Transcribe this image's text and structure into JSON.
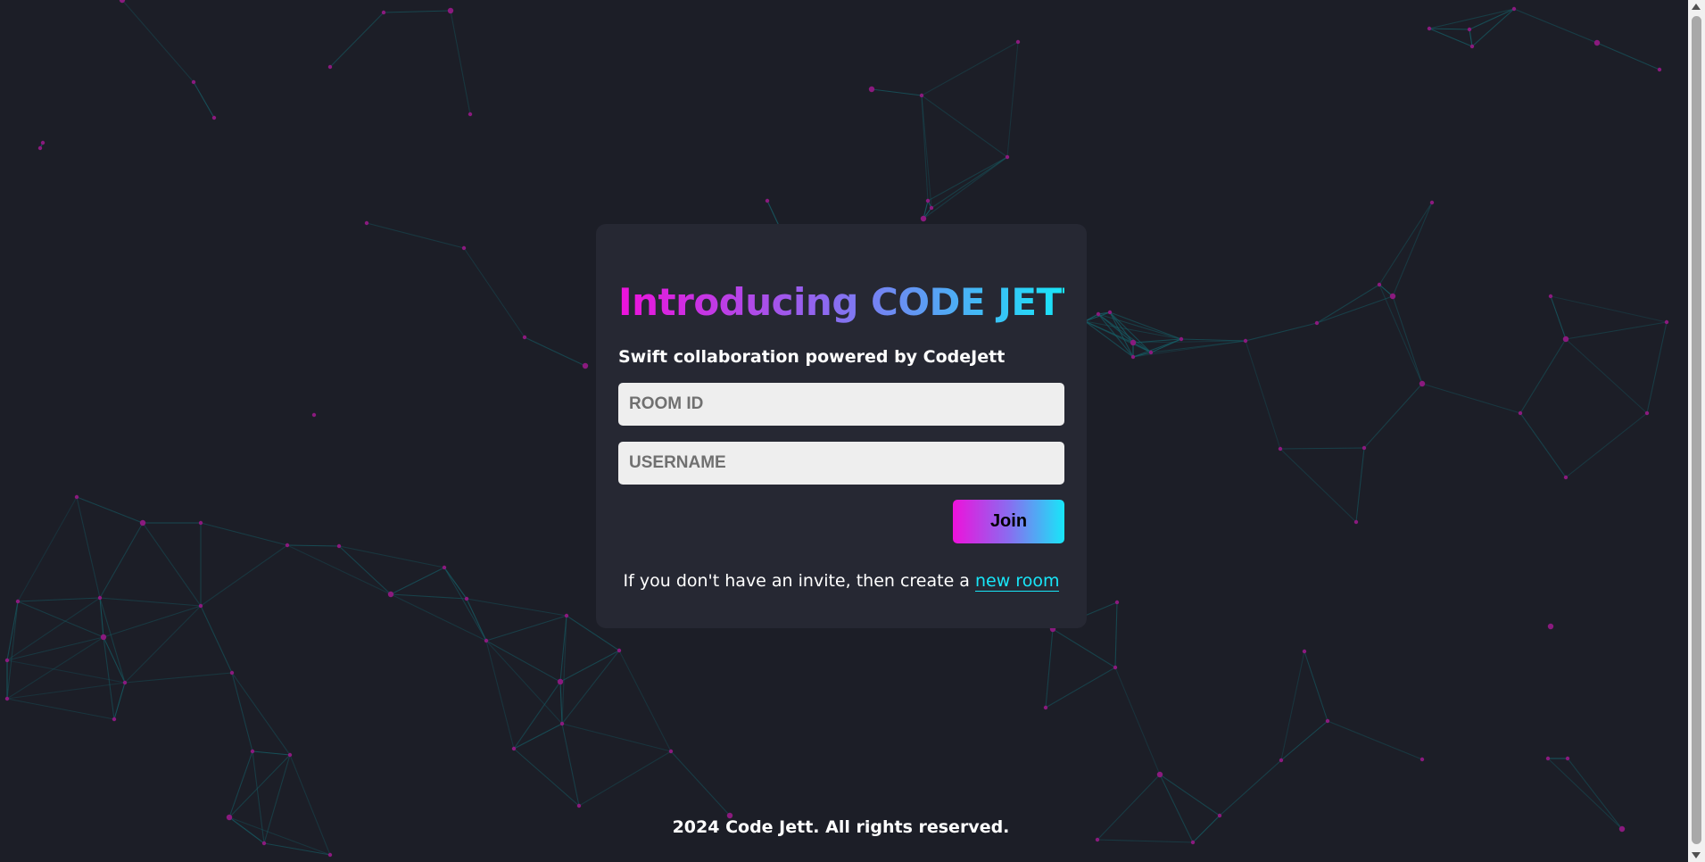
{
  "colors": {
    "background": "#1c1e27",
    "card": "#262833",
    "accent_pink": "#ee11db",
    "accent_cyan": "#18e6f8",
    "network_line": "#15656d",
    "network_node": "#8a1a7e"
  },
  "card": {
    "title": "Introducing CODE JETT",
    "subtitle": "Swift collaboration powered by CodeJett",
    "room_id_placeholder": "ROOM ID",
    "username_placeholder": "USERNAME",
    "join_label": "Join",
    "invite_text": "If you don't have an invite, then create a ",
    "new_room_link": "new room"
  },
  "footer": {
    "text": "2024 Code Jett. All rights reserved."
  },
  "background": {
    "description_icon": "particle-network-background"
  }
}
